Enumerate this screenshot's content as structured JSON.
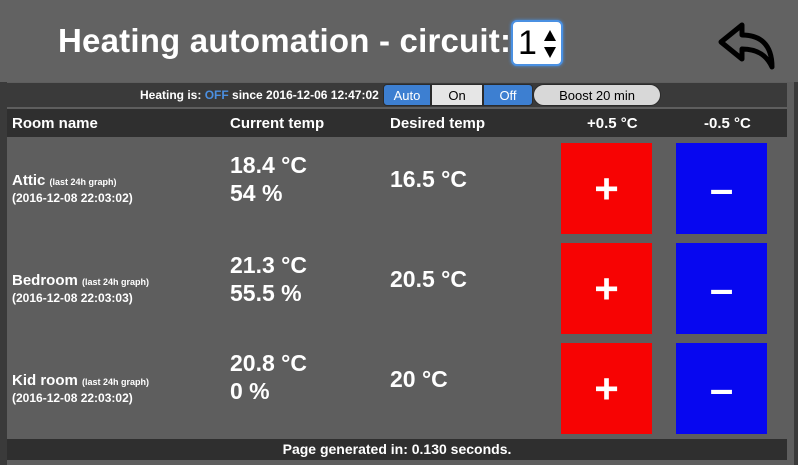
{
  "header": {
    "title": "Heating automation - circuit:",
    "circuit_value": "1",
    "back_icon": "back-arrow-icon"
  },
  "status": {
    "prefix": "Heating is:",
    "state": "OFF",
    "since": "since 2016-12-06 12:47:02",
    "modes": {
      "auto": "Auto",
      "on": "On",
      "off": "Off"
    },
    "boost": "Boost 20 min",
    "active_color": "#3d7fd1"
  },
  "table": {
    "headers": {
      "room": "Room name",
      "current": "Current temp",
      "desired": "Desired temp",
      "plus": "+0.5 °C",
      "minus": "-0.5 °C"
    },
    "rows": [
      {
        "name": "Attic",
        "graph": "(last 24h graph)",
        "date": "(2016-12-08 22:03:02)",
        "temp": "18.4 °C",
        "humidity": "54 %",
        "desired": "16.5 °C",
        "plus": "+",
        "minus": "–"
      },
      {
        "name": "Bedroom",
        "graph": "(last 24h graph)",
        "date": "(2016-12-08 22:03:03)",
        "temp": "21.3 °C",
        "humidity": "55.5 %",
        "desired": "20.5 °C",
        "plus": "+",
        "minus": "–"
      },
      {
        "name": "Kid room",
        "graph": "(last 24h graph)",
        "date": "(2016-12-08 22:03:02)",
        "temp": "20.8 °C",
        "humidity": "0 %",
        "desired": "20 °C",
        "plus": "+",
        "minus": "–"
      }
    ]
  },
  "footer": {
    "text": "Page generated in: 0.130 seconds."
  },
  "colors": {
    "plus_button": "#f70303",
    "minus_button": "#0707f0",
    "background": "#5e5e5e"
  }
}
